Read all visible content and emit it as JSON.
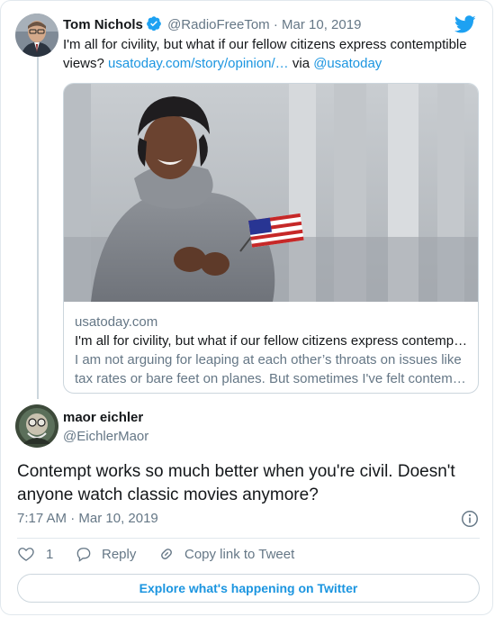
{
  "quoted_tweet": {
    "author_name": "Tom Nichols",
    "handle": "@RadioFreeTom",
    "separator": "·",
    "date": "Mar 10, 2019",
    "text_part1": "I'm all for civility, but what if our fellow citizens express contemptible views? ",
    "text_link": "usatoday.com/story/opinion/…",
    "text_via": " via ",
    "text_mention": "@usatoday",
    "link_card": {
      "domain": "usatoday.com",
      "title": "I'm all for civility, but what if our fellow citizens express contemptible views?",
      "description_line1": "I am not arguing for leaping at each other’s throats on issues like",
      "description_line2": "tax rates or bare feet on planes. But sometimes I've felt contemptuous"
    }
  },
  "tweet": {
    "author_name": "maor eichler",
    "handle": "@EichlerMaor",
    "text": "Contempt works so much better when you're civil. Doesn't anyone watch classic movies anymore?",
    "time": "7:17 AM",
    "separator": "·",
    "date": "Mar 10, 2019"
  },
  "actions": {
    "like_count": "1",
    "reply_label": "Reply",
    "copy_link_label": "Copy link to Tweet"
  },
  "explore_label": "Explore what's happening on Twitter",
  "icons": {
    "logo": "twitter-bird-icon",
    "verified": "verified-badge-icon",
    "info": "info-icon",
    "like": "heart-icon",
    "reply": "reply-bubble-icon",
    "copy": "link-icon"
  },
  "colors": {
    "brand": "#1da1f2",
    "link": "#1b95e0",
    "muted": "#657786",
    "text": "#14171a",
    "border": "#e1e8ed"
  }
}
